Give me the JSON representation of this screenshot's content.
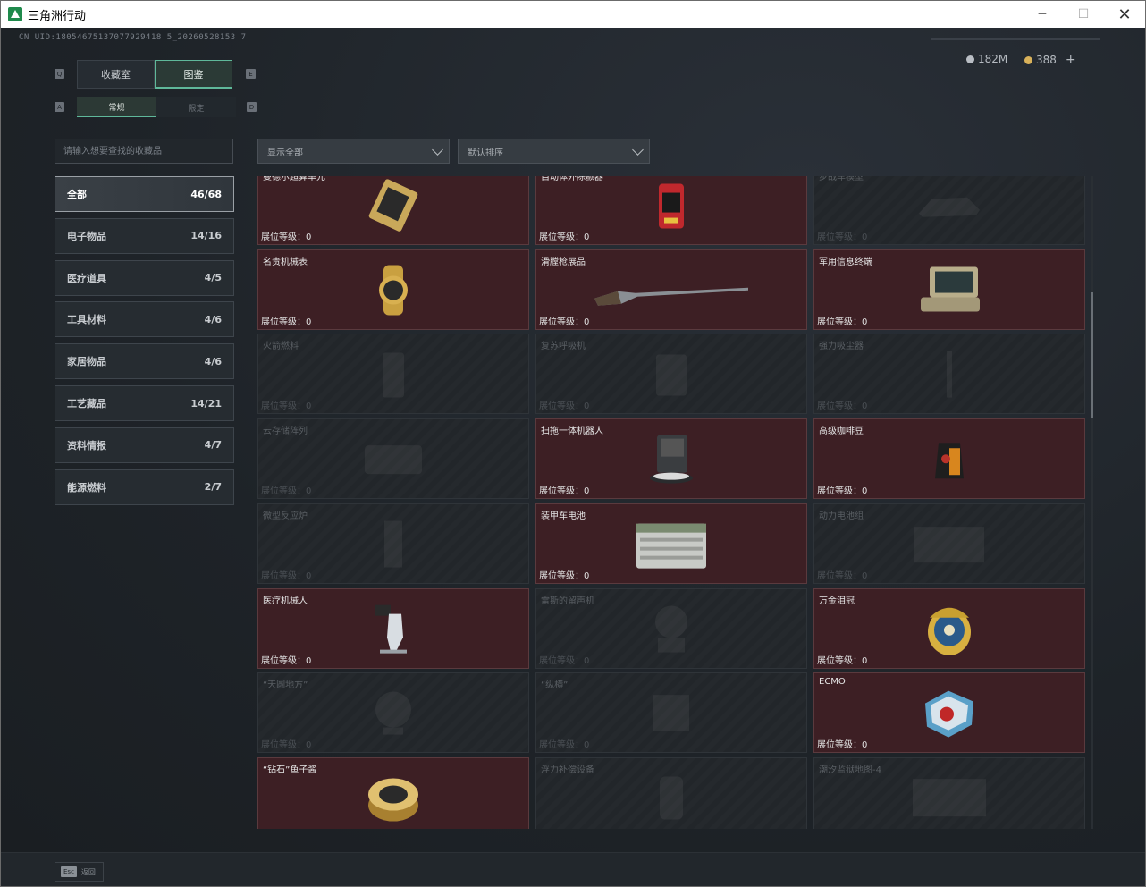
{
  "window": {
    "title": "三角洲行动",
    "minimize": "─",
    "maximize": "☐",
    "close": "✕"
  },
  "uid": "CN UID:18054675137077929418 5_20260528153 7",
  "currency": {
    "silver": "182M",
    "gold": "388",
    "plus": "+"
  },
  "tabs": {
    "key_left": "Q",
    "key_right": "E",
    "items": [
      {
        "label": "收藏室"
      },
      {
        "label": "图鉴"
      }
    ],
    "sub_key_left": "A",
    "sub_key_right": "D",
    "sub": [
      {
        "label": "常规"
      },
      {
        "label": "限定"
      }
    ]
  },
  "search": {
    "placeholder": "请输入想要查找的收藏品"
  },
  "filters": {
    "display": "显示全部",
    "sort": "默认排序"
  },
  "categories": [
    {
      "label": "全部",
      "count": "46/68"
    },
    {
      "label": "电子物品",
      "count": "14/16"
    },
    {
      "label": "医疗道具",
      "count": "4/5"
    },
    {
      "label": "工具材料",
      "count": "4/6"
    },
    {
      "label": "家居物品",
      "count": "4/6"
    },
    {
      "label": "工艺藏品",
      "count": "14/21"
    },
    {
      "label": "资料情报",
      "count": "4/7"
    },
    {
      "label": "能源燃料",
      "count": "2/7"
    }
  ],
  "level_label": "展位等级：",
  "items": [
    {
      "name": "曼德尔超算单元",
      "level": "0",
      "owned": true,
      "icon": "computer-chip-icon"
    },
    {
      "name": "自动体外除颤器",
      "level": "0",
      "owned": true,
      "icon": "defibrillator-icon"
    },
    {
      "name": "步战车模型",
      "level": "0",
      "owned": false,
      "icon": "vehicle-model-icon"
    },
    {
      "name": "名贵机械表",
      "level": "0",
      "owned": true,
      "icon": "watch-icon"
    },
    {
      "name": "滑膛枪展品",
      "level": "0",
      "owned": true,
      "icon": "musket-icon"
    },
    {
      "name": "军用信息终端",
      "level": "0",
      "owned": true,
      "icon": "terminal-icon"
    },
    {
      "name": "火箭燃料",
      "level": "0",
      "owned": false,
      "icon": "fuel-icon"
    },
    {
      "name": "复苏呼吸机",
      "level": "0",
      "owned": false,
      "icon": "ventilator-icon"
    },
    {
      "name": "强力吸尘器",
      "level": "0",
      "owned": false,
      "icon": "vacuum-icon"
    },
    {
      "name": "云存储阵列",
      "level": "0",
      "owned": false,
      "icon": "storage-array-icon"
    },
    {
      "name": "扫拖一体机器人",
      "level": "0",
      "owned": true,
      "icon": "robot-vacuum-icon"
    },
    {
      "name": "高级咖啡豆",
      "level": "0",
      "owned": true,
      "icon": "coffee-bag-icon"
    },
    {
      "name": "微型反应炉",
      "level": "0",
      "owned": false,
      "icon": "reactor-icon"
    },
    {
      "name": "装甲车电池",
      "level": "0",
      "owned": true,
      "icon": "battery-icon"
    },
    {
      "name": "动力电池组",
      "level": "0",
      "owned": false,
      "icon": "power-pack-icon"
    },
    {
      "name": "医疗机械人",
      "level": "0",
      "owned": true,
      "icon": "medical-robot-icon"
    },
    {
      "name": "雷斯的留声机",
      "level": "0",
      "owned": false,
      "icon": "gramophone-icon"
    },
    {
      "name": "万金泪冠",
      "level": "0",
      "owned": true,
      "icon": "jeweled-egg-icon"
    },
    {
      "name": "“天圆地方”",
      "level": "0",
      "owned": false,
      "icon": "globe-icon"
    },
    {
      "name": "“纵横”",
      "level": "0",
      "owned": false,
      "icon": "chessboard-icon"
    },
    {
      "name": "ECMO",
      "level": "0",
      "owned": true,
      "icon": "ecmo-icon"
    },
    {
      "name": "“钻石”鱼子酱",
      "level": "",
      "owned": true,
      "icon": "caviar-tin-icon"
    },
    {
      "name": "浮力补偿设备",
      "level": "",
      "owned": false,
      "icon": "buoyancy-icon"
    },
    {
      "name": "潮汐监狱地图-4",
      "level": "",
      "owned": false,
      "icon": "map-icon"
    }
  ],
  "footer": {
    "key": "Esc",
    "label": "返回"
  }
}
